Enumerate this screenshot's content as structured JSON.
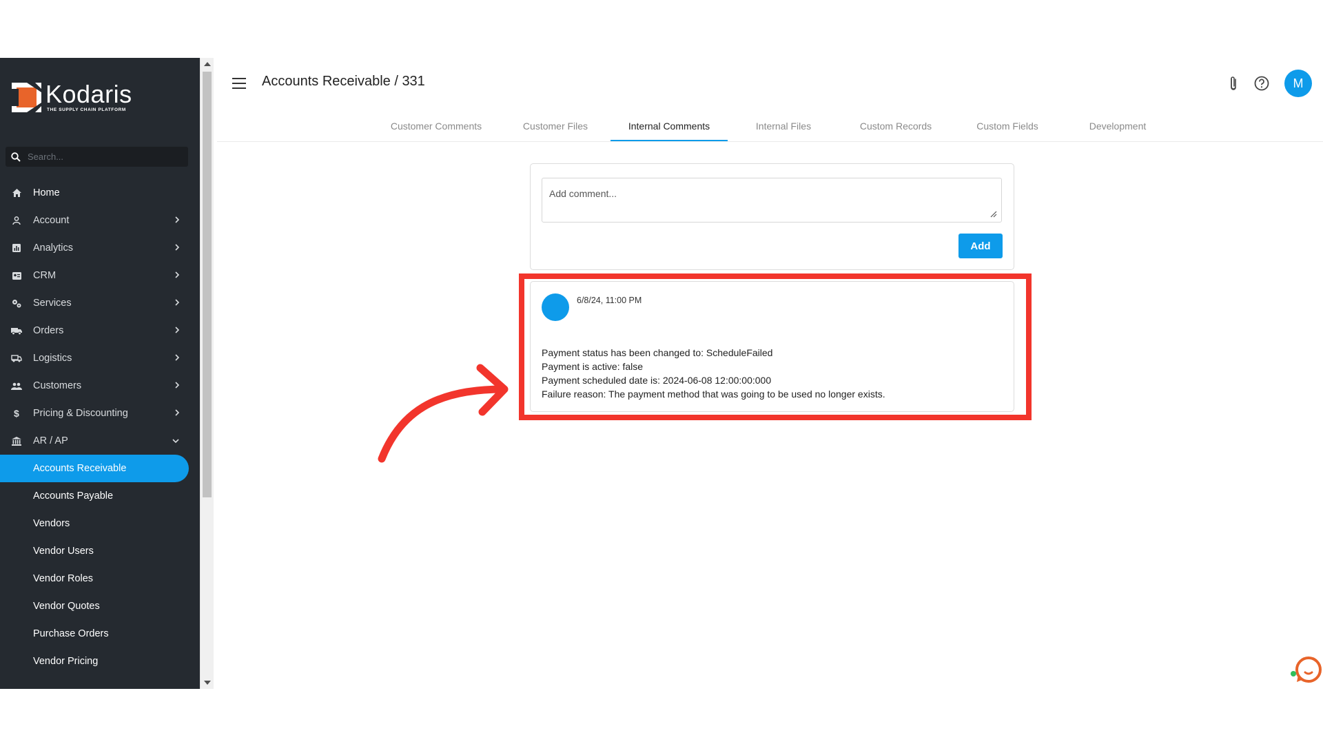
{
  "app": {
    "brand": "Kodaris",
    "tagline": "THE SUPPLY CHAIN PLATFORM"
  },
  "search": {
    "placeholder": "Search..."
  },
  "sidebar": {
    "items": [
      {
        "label": "Home",
        "icon": "home-icon"
      },
      {
        "label": "Account",
        "icon": "person-icon"
      },
      {
        "label": "Analytics",
        "icon": "chart-icon"
      },
      {
        "label": "CRM",
        "icon": "contacts-icon"
      },
      {
        "label": "Services",
        "icon": "gears-icon"
      },
      {
        "label": "Orders",
        "icon": "truck-icon"
      },
      {
        "label": "Logistics",
        "icon": "shipping-icon"
      },
      {
        "label": "Customers",
        "icon": "group-icon"
      },
      {
        "label": "Pricing & Discounting",
        "icon": "dollar-icon"
      },
      {
        "label": "AR / AP",
        "icon": "bank-icon"
      }
    ],
    "sub_items": [
      {
        "label": "Accounts Receivable",
        "active": true
      },
      {
        "label": "Accounts Payable"
      },
      {
        "label": "Vendors"
      },
      {
        "label": "Vendor Users"
      },
      {
        "label": "Vendor Roles"
      },
      {
        "label": "Vendor Quotes"
      },
      {
        "label": "Purchase Orders"
      },
      {
        "label": "Vendor Pricing"
      }
    ]
  },
  "header": {
    "title": "Accounts Receivable / 331",
    "avatar_initial": "M"
  },
  "tabs": [
    {
      "label": "Customer Comments"
    },
    {
      "label": "Customer Files"
    },
    {
      "label": "Internal Comments",
      "active": true
    },
    {
      "label": "Internal Files"
    },
    {
      "label": "Custom Records"
    },
    {
      "label": "Custom Fields"
    },
    {
      "label": "Development"
    }
  ],
  "editor": {
    "placeholder": "Add comment...",
    "button": "Add"
  },
  "comment": {
    "date": "6/8/24, 11:00 PM",
    "lines": [
      "Payment status has been changed to: ScheduleFailed",
      "Payment is active: false",
      "Payment scheduled date is: 2024-06-08 12:00:00:000",
      "Failure reason: The payment method that was going to be used no longer exists."
    ]
  },
  "colors": {
    "accent": "#0e9bea",
    "sidebar": "#252a30",
    "highlight": "#f2352c",
    "logo_orange": "#e8642a"
  }
}
